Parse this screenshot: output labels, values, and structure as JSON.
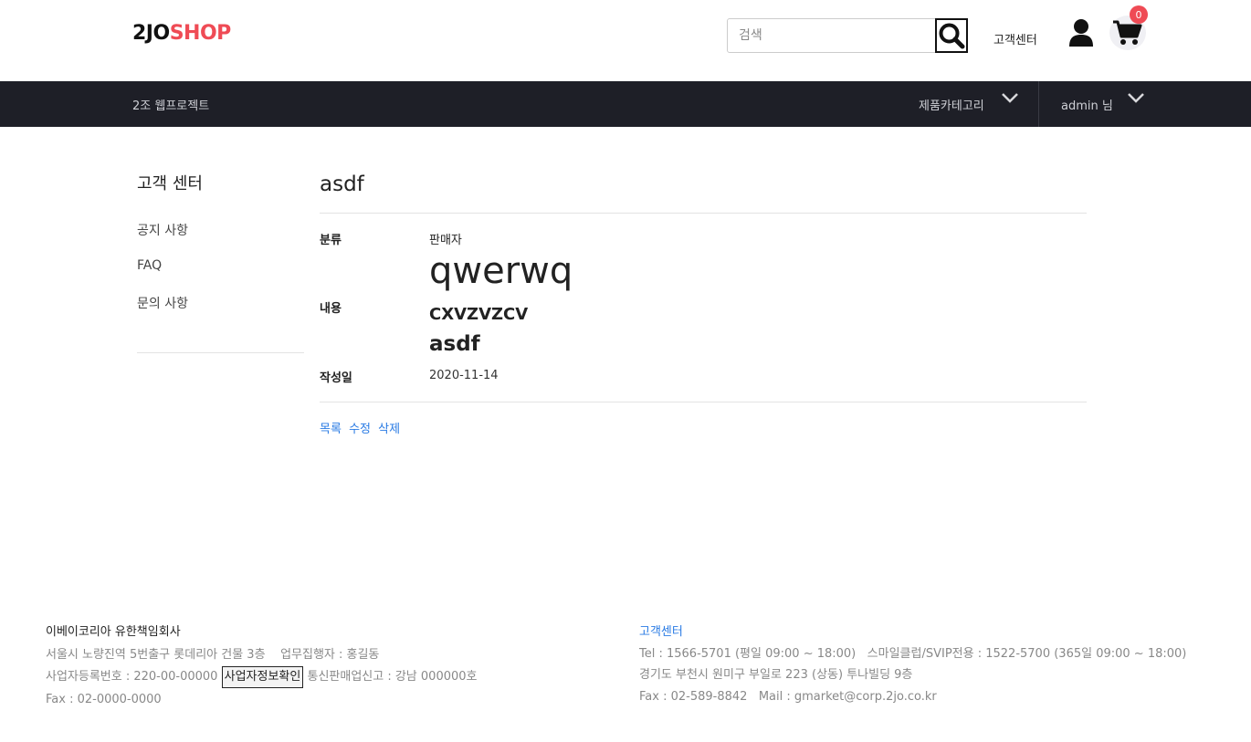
{
  "header": {
    "logo_part1": "2JO",
    "logo_part2": "SHOP",
    "search_placeholder": "검색",
    "search_icon": "search-icon",
    "customer_center": "고객센터",
    "user_icon": "user-icon",
    "cart_icon": "cart-icon",
    "cart_count": "0"
  },
  "nav": {
    "brand": "2조 웹프로젝트",
    "category": "제품카테고리",
    "user": "admin 님"
  },
  "sidebar": {
    "title": "고객 센터",
    "items": [
      {
        "label": "공지 사항"
      },
      {
        "label": "FAQ"
      },
      {
        "label": "문의 사항"
      }
    ]
  },
  "article": {
    "title": "asdf",
    "category_label": "분류",
    "category_value": "판매자",
    "content_label": "내용",
    "content_h1": "qwerwq",
    "content_h3": "CXVZVZCV",
    "content_h2": "asdf",
    "date_label": "작성일",
    "date_value": "2020-11-14",
    "actions": {
      "list": "목록",
      "edit": "수정",
      "delete": "삭제"
    }
  },
  "footer": {
    "company": "이베이코리아 유한책임회사",
    "address": "서울시 노량진역 5번출구 롯데리아 건물 3층",
    "ceo": "업무집행자 : 홍길동",
    "biz_number": "사업자등록번호 : 220-00-00000",
    "biz_check_button": "사업자정보확인",
    "ecommerce": "통신판매업신고 : 강남 000000호",
    "fax": "Fax : 02-0000-0000",
    "cs_title": "고객센터",
    "tel": "Tel : 1566-5701 (평일 09:00 ~ 18:00)",
    "vip": "스마일클럽/SVIP전용 : 1522-5700 (365일 09:00 ~ 18:00)",
    "cs_address": "경기도 부천시 원미구 부일로 223 (상동) 투나빌딩 9층",
    "cs_fax": "Fax : 02-589-8842",
    "mail": "Mail : gmarket@corp.2jo.co.kr"
  }
}
